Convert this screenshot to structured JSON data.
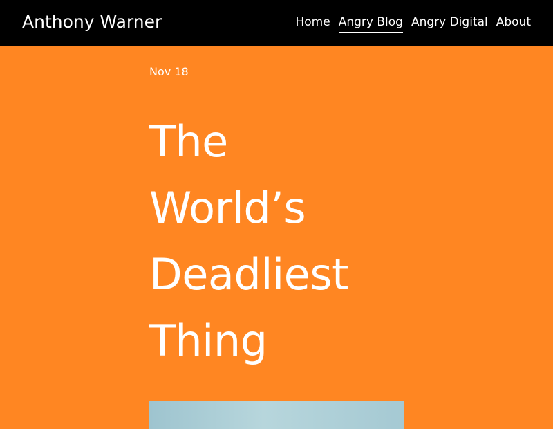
{
  "header": {
    "site_title": "Anthony Warner",
    "nav": [
      {
        "label": "Home",
        "active": false
      },
      {
        "label": "Angry Blog",
        "active": true
      },
      {
        "label": "Angry Digital",
        "active": false
      },
      {
        "label": "About",
        "active": false
      }
    ]
  },
  "post": {
    "date": "Nov 18",
    "title_lines": [
      "The",
      "World’s",
      "Deadliest",
      "Thing"
    ]
  },
  "colors": {
    "background": "#ff8622",
    "header": "#000000",
    "text": "#ffffff"
  }
}
